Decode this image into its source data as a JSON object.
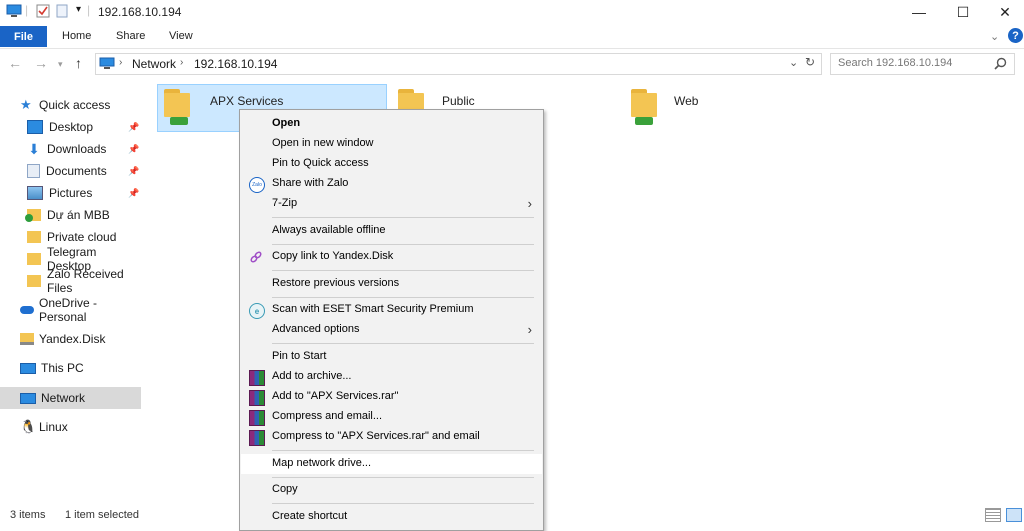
{
  "window": {
    "title": "192.168.10.194",
    "controls": {
      "minimize": "—",
      "maximize": "☐",
      "close": "✕"
    }
  },
  "ribbon": {
    "file_label": "File",
    "tabs": [
      "Home",
      "Share",
      "View"
    ]
  },
  "address": {
    "crumbs": [
      "Network",
      "192.168.10.194"
    ],
    "search_placeholder": "Search 192.168.10.194"
  },
  "sidebar": {
    "quick_access": "Quick access",
    "items": [
      {
        "label": "Desktop",
        "icon": "desktop-icon",
        "pinned": true
      },
      {
        "label": "Downloads",
        "icon": "download-icon",
        "pinned": true
      },
      {
        "label": "Documents",
        "icon": "documents-icon",
        "pinned": true
      },
      {
        "label": "Pictures",
        "icon": "pictures-icon",
        "pinned": true
      },
      {
        "label": "Dự án MBB",
        "icon": "folder-sync-icon",
        "pinned": false
      },
      {
        "label": "Private cloud",
        "icon": "folder-icon",
        "pinned": false
      },
      {
        "label": "Telegram Desktop",
        "icon": "folder-icon",
        "pinned": false
      },
      {
        "label": "Zalo Received Files",
        "icon": "folder-icon",
        "pinned": false
      }
    ],
    "onedrive": "OneDrive - Personal",
    "yandex": "Yandex.Disk",
    "this_pc": "This PC",
    "network": "Network",
    "linux": "Linux"
  },
  "files": [
    {
      "name": "APX Services",
      "selected": true
    },
    {
      "name": "Public",
      "selected": false
    },
    {
      "name": "Web",
      "selected": false
    }
  ],
  "context_menu": {
    "items": [
      {
        "label": "Open",
        "bold": true
      },
      {
        "label": "Open in new window"
      },
      {
        "label": "Pin to Quick access"
      },
      {
        "label": "Share with Zalo",
        "icon": "zalo-icon"
      },
      {
        "label": "7-Zip",
        "submenu": true
      },
      {
        "label": "Always available offline"
      },
      {
        "label": "Copy link to Yandex.Disk",
        "icon": "link-icon"
      },
      {
        "label": "Restore previous versions"
      },
      {
        "label": "Scan with ESET Smart Security Premium",
        "icon": "eset-icon"
      },
      {
        "label": "Advanced options",
        "submenu": true
      },
      {
        "label": "Pin to Start"
      },
      {
        "label": "Add to archive...",
        "icon": "winrar-icon"
      },
      {
        "label": "Add to \"APX Services.rar\"",
        "icon": "winrar-icon"
      },
      {
        "label": "Compress and email...",
        "icon": "winrar-icon"
      },
      {
        "label": "Compress to \"APX Services.rar\" and email",
        "icon": "winrar-icon"
      },
      {
        "label": "Map network drive..."
      },
      {
        "label": "Copy"
      },
      {
        "label": "Create shortcut"
      }
    ],
    "submenu_arrow": "›",
    "zalo_text": "Zalo"
  },
  "status": {
    "item_count": "3 items",
    "selection": "1 item selected"
  },
  "colors": {
    "accent": "#1a64c6",
    "selection": "#cce8ff",
    "selection_border": "#99d1ff",
    "menu_hover": "#ffffff"
  }
}
